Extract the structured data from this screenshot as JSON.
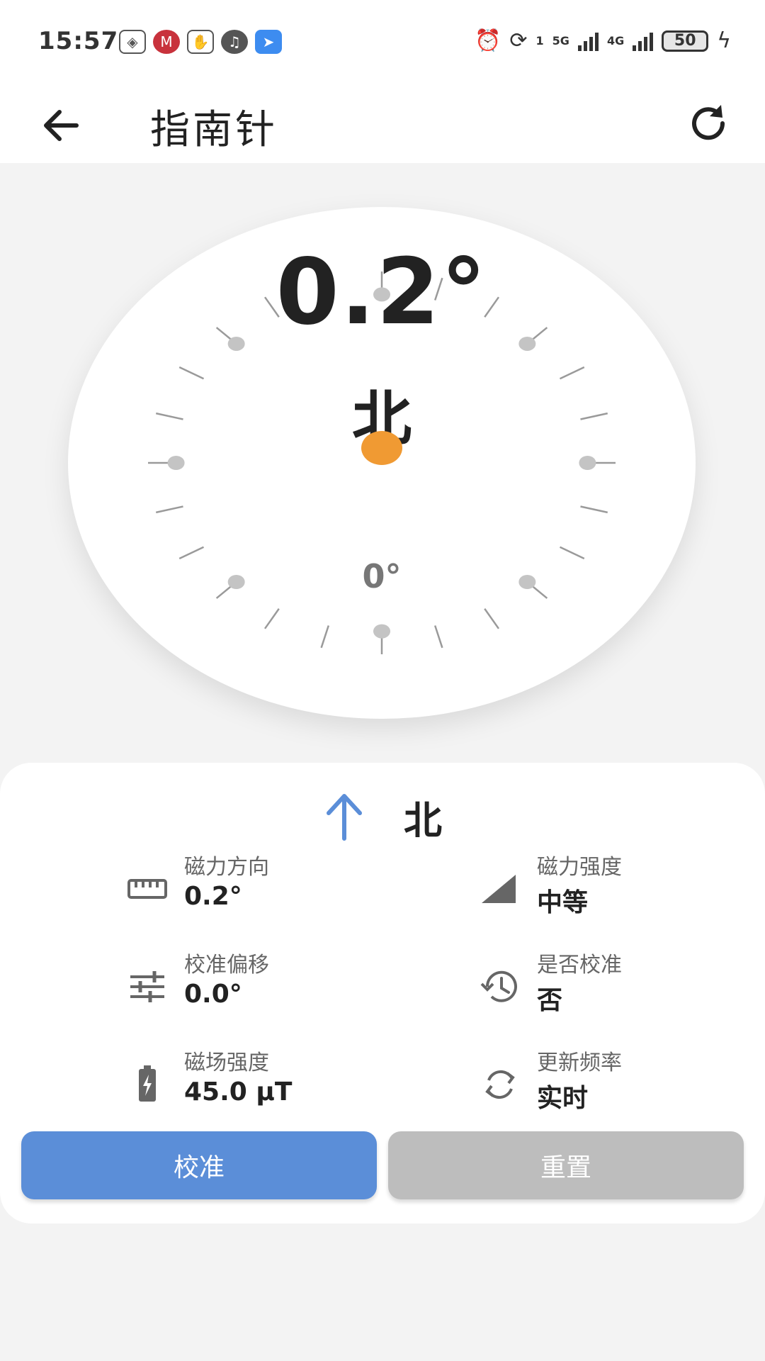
{
  "status_bar": {
    "time": "15:57",
    "left_icons": [
      "app-diamond-icon",
      "bank-icon",
      "hand-icon",
      "voice-icon",
      "message-icon"
    ],
    "network_1": "5G",
    "network_2": "4G",
    "sim_indicator": "1",
    "battery": "50"
  },
  "app_bar": {
    "title": "指南针"
  },
  "compass": {
    "heading_degrees": "0.2°",
    "direction": "北",
    "dial_degrees": "0°"
  },
  "panel": {
    "direction_label": "北",
    "stats": [
      {
        "label": "磁力方向",
        "value": "0.2°",
        "icon": "ruler-icon"
      },
      {
        "label": "磁力强度",
        "value": "中等",
        "icon": "signal-strength-icon"
      },
      {
        "label": "校准偏移",
        "value": "0.0°",
        "icon": "tune-icon"
      },
      {
        "label": "是否校准",
        "value": "否",
        "icon": "history-icon"
      },
      {
        "label": "磁场强度",
        "value": "45.0 μT",
        "icon": "battery-charging-icon"
      },
      {
        "label": "更新频率",
        "value": "实时",
        "icon": "sync-icon"
      }
    ],
    "calibrate_button": "校准",
    "reset_button": "重置"
  },
  "colors": {
    "accent": "#5b8ed8",
    "needle": "#f09a33",
    "disabled": "#bdbdbd"
  }
}
